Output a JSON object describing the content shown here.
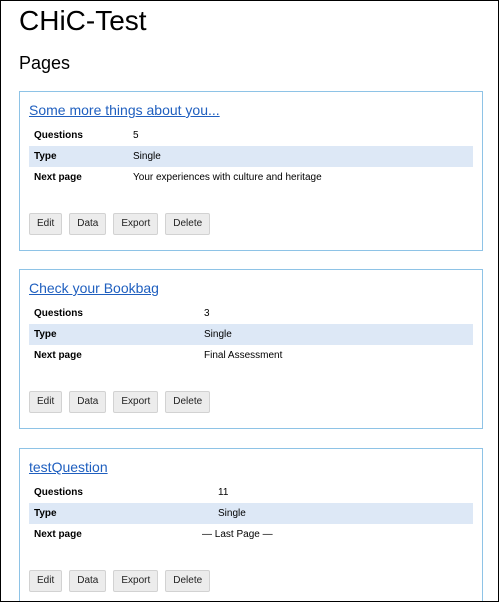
{
  "app": {
    "title": "CHiC-Test"
  },
  "section": {
    "title": "Pages"
  },
  "labels": {
    "questions": "Questions",
    "type": "Type",
    "next_page": "Next page"
  },
  "buttons": {
    "edit": "Edit",
    "data": "Data",
    "export": "Export",
    "delete": "Delete"
  },
  "pages": [
    {
      "title": "Some more things about you...",
      "questions": "5",
      "type": "Single",
      "next_page": "Your experiences with culture and heritage"
    },
    {
      "title": "Check your Bookbag",
      "questions": "3",
      "type": "Single",
      "next_page": "Final Assessment"
    },
    {
      "title": "testQuestion",
      "questions": "11",
      "type": "Single",
      "next_page": "— Last Page —"
    }
  ],
  "colors": {
    "link": "#1f5fbf",
    "card_border": "#8ec3e6",
    "row_shade": "#dde8f6",
    "button_bg": "#ececec"
  }
}
